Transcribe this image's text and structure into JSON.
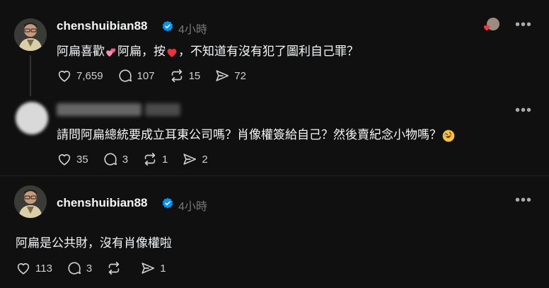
{
  "posts": [
    {
      "username": "chenshuibian88",
      "time": "4小時",
      "text_a": "阿扁喜歡",
      "text_b": "阿扁，按",
      "text_c": "，不知道有沒有犯了圖利自己罪？",
      "likes": "7,659",
      "comments": "107",
      "reposts": "15",
      "shares": "72"
    },
    {
      "username": "",
      "time": "",
      "text": "請問阿扁總統要成立耳東公司嗎？肖像權簽給自己？然後賣紀念小物嗎？",
      "likes": "35",
      "comments": "3",
      "reposts": "1",
      "shares": "2"
    },
    {
      "username": "chenshuibian88",
      "time": "4小時",
      "text": "阿扁是公共財，沒有肖像權啦",
      "likes": "113",
      "comments": "3",
      "reposts": "",
      "shares": "1"
    }
  ],
  "icons": {
    "more": "more-icon",
    "like": "heart-icon",
    "comment": "comment-icon",
    "repost": "repost-icon",
    "share": "share-icon",
    "verified": "verified-badge-icon"
  },
  "colors": {
    "background": "#101010",
    "verified": "#0095f6",
    "heart": "#ff3040",
    "muted": "#777777"
  }
}
